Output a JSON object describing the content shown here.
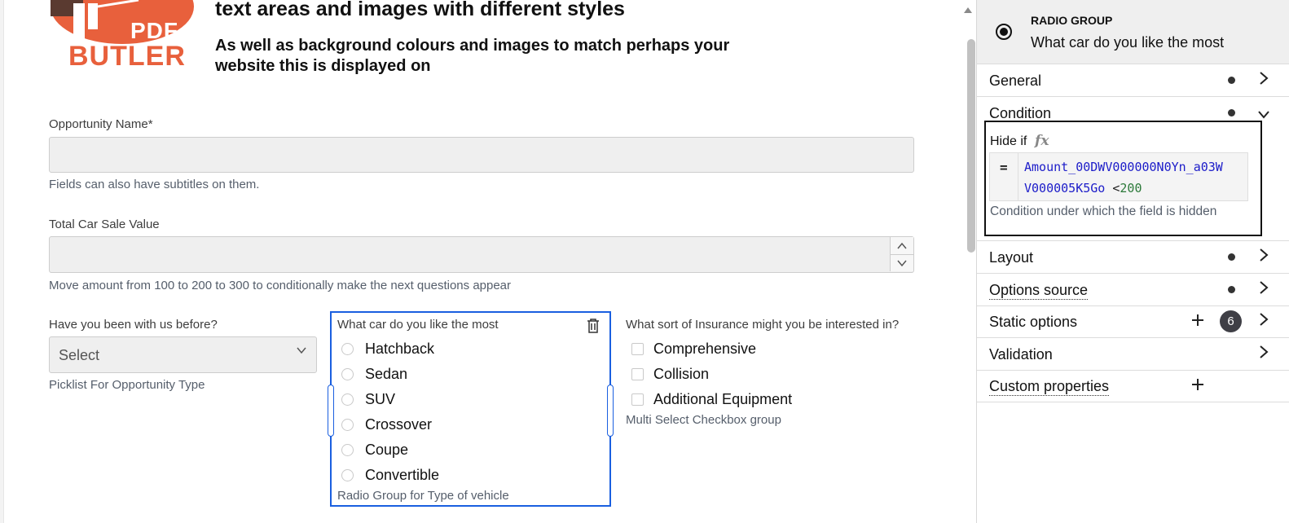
{
  "logo": {
    "line1": "PDF",
    "line2": "BUTLER",
    "color": "#e8603c"
  },
  "form": {
    "heading1": "text areas and images with different styles",
    "heading2": "As well as background colours and images to match perhaps your website this is displayed on",
    "heading2_line1": "As well as background colours and images to match perhaps your",
    "heading2_line2": "website this is displayed on",
    "opportunity": {
      "label": "Opportunity Name*",
      "value": "",
      "subtitle": "Fields can also have subtitles on them."
    },
    "total": {
      "label": "Total Car Sale Value",
      "value": "",
      "subtitle": "Move amount from 100 to 200 to 300 to conditionally make the next questions appear"
    },
    "been_with_us": {
      "label": "Have you been with us before?",
      "selected": "Select",
      "subtitle": "Picklist For Opportunity Type"
    },
    "car": {
      "label": "What car do you like the most",
      "options": [
        "Hatchback",
        "Sedan",
        "SUV",
        "Crossover",
        "Coupe",
        "Convertible"
      ],
      "subtitle": "Radio Group for Type of vehicle"
    },
    "insurance": {
      "label": "What sort of Insurance might you be interested in?",
      "options": [
        "Comprehensive",
        "Collision",
        "Additional Equipment"
      ],
      "subtitle": "Multi Select Checkbox group"
    }
  },
  "panel": {
    "type": "RADIO GROUP",
    "title": "What car do you like the most",
    "sections": {
      "general": "General",
      "condition": "Condition",
      "layout": "Layout",
      "options_source": "Options source",
      "static_options": "Static options",
      "static_options_count": "6",
      "validation": "Validation",
      "custom_properties": "Custom properties"
    },
    "condition": {
      "hide_if_label": "Hide if",
      "fx": "fx",
      "equals": "=",
      "expr_line1": "Amount_00DWV000000N0Yn_a03W",
      "expr_line2": "V000005K5Go",
      "operator": "<",
      "number": "200",
      "help": "Condition under which the field is hidden"
    }
  },
  "colors": {
    "accent": "#1a5fe0",
    "expr_field": "#1c1cc9",
    "expr_number": "#2c7a3a"
  }
}
